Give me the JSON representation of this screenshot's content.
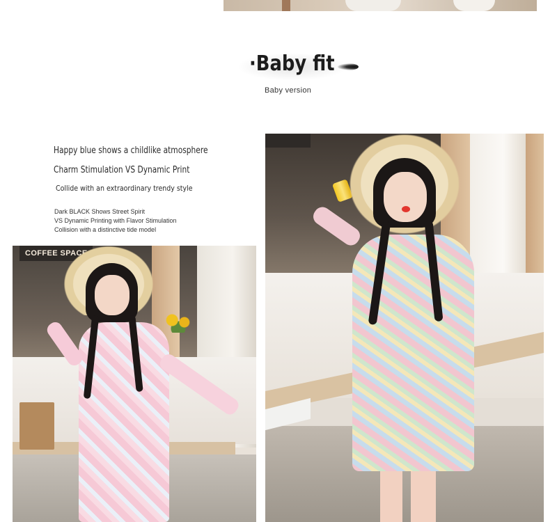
{
  "heading": {
    "title": "·Baby fit",
    "subtitle": "Baby version"
  },
  "copy": {
    "line1": "Happy blue shows a childlike atmosphere",
    "line2": "Charm Stimulation VS Dynamic Print",
    "line3": "Collide with an extraordinary trendy style",
    "small1": "Dark BLACK Shows Street Spirit",
    "small2": "VS Dynamic Printing with Flavor Stimulation",
    "small3": "Collision with a distinctive tide model"
  },
  "photos": {
    "left_sign": "COFFEE SPACE"
  }
}
